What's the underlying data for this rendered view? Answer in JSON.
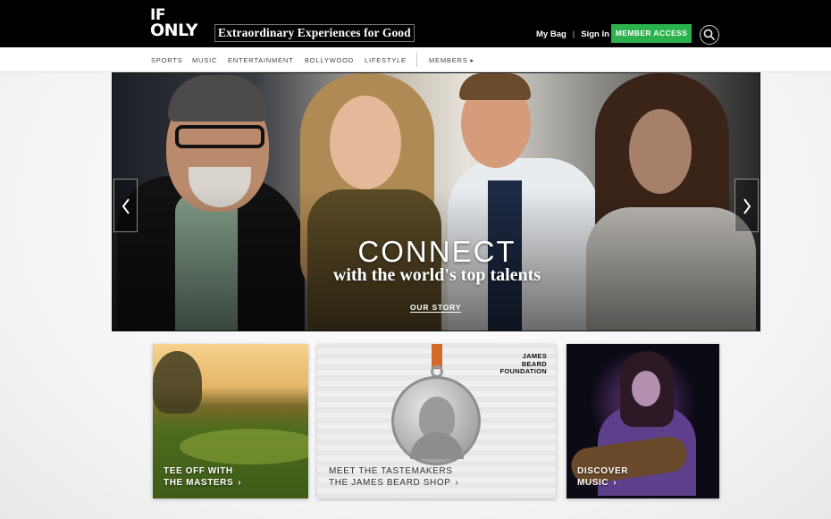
{
  "header": {
    "logo_line1": "IF",
    "logo_line2": "ONLY",
    "tagline": "Extraordinary Experiences for Good",
    "my_bag": "My Bag",
    "separator": "|",
    "sign_in": "Sign In",
    "member_access": "MEMBER ACCESS",
    "accent_color": "#2bb24c"
  },
  "nav": {
    "items": [
      "SPORTS",
      "MUSIC",
      "ENTERTAINMENT",
      "BOLLYWOOD",
      "LIFESTYLE"
    ],
    "members": "MEMBERS ▸"
  },
  "hero": {
    "title": "CONNECT",
    "subtitle": "with the world's top talents",
    "link": "OUR STORY",
    "prev_icon": "chevron-left-icon",
    "next_icon": "chevron-right-icon"
  },
  "tiles": [
    {
      "line1": "TEE OFF WITH",
      "line2": "THE MASTERS"
    },
    {
      "line1": "MEET THE TASTEMAKERS",
      "line2": "THE JAMES BEARD SHOP",
      "badge_line1": "JAMES",
      "badge_line2": "BEARD",
      "badge_line3": "FOUNDATION"
    },
    {
      "line1": "DISCOVER",
      "line2": "MUSIC"
    }
  ],
  "icons": {
    "search": "search-icon",
    "chevron": "chevron-right-icon"
  }
}
